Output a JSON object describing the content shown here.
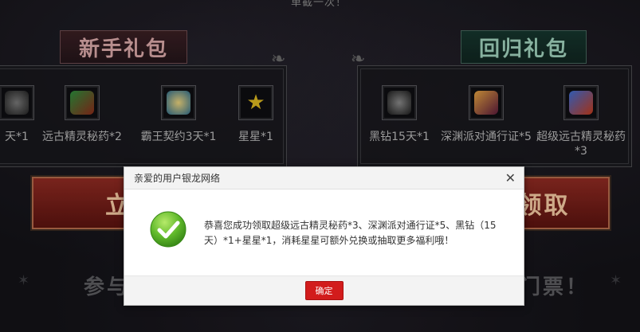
{
  "top_text": "单截一次！",
  "left_section": {
    "title": "新手礼包",
    "items": [
      {
        "label": "天*1",
        "icon": "black-diamond-icon",
        "color": "#3a3a3a"
      },
      {
        "label": "远古精灵秘药*2",
        "icon": "exp-potion-icon",
        "color": "#5a2a1a"
      },
      {
        "label": "霸王契约3天*1",
        "icon": "contract-icon",
        "color": "#2b6a8a"
      },
      {
        "label": "星星*1",
        "icon": "star-icon",
        "color": "#c9a81a"
      }
    ],
    "button": "立即"
  },
  "right_section": {
    "title": "回归礼包",
    "items": [
      {
        "label": "黑钻15天*1",
        "icon": "black-diamond-icon",
        "color": "#3a3a3a"
      },
      {
        "label": "深渊派对通行证*5",
        "icon": "pass-icon",
        "color": "#6a3a1a"
      },
      {
        "label": "超级远古精灵秘药*3",
        "icon": "super-exp-potion-icon",
        "color": "#1a3a7a"
      }
    ],
    "button": "领取"
  },
  "bottom_left": "参与",
  "bottom_right": "门票！",
  "modal": {
    "title": "亲爱的用户银龙网络",
    "message": "恭喜您成功领取超级远古精灵秘药*3、深渊派对通行证*5、黑钻（15天）*1+星星*1，消耗星星可额外兑换或抽取更多福利哦！",
    "ok_label": "确定"
  }
}
